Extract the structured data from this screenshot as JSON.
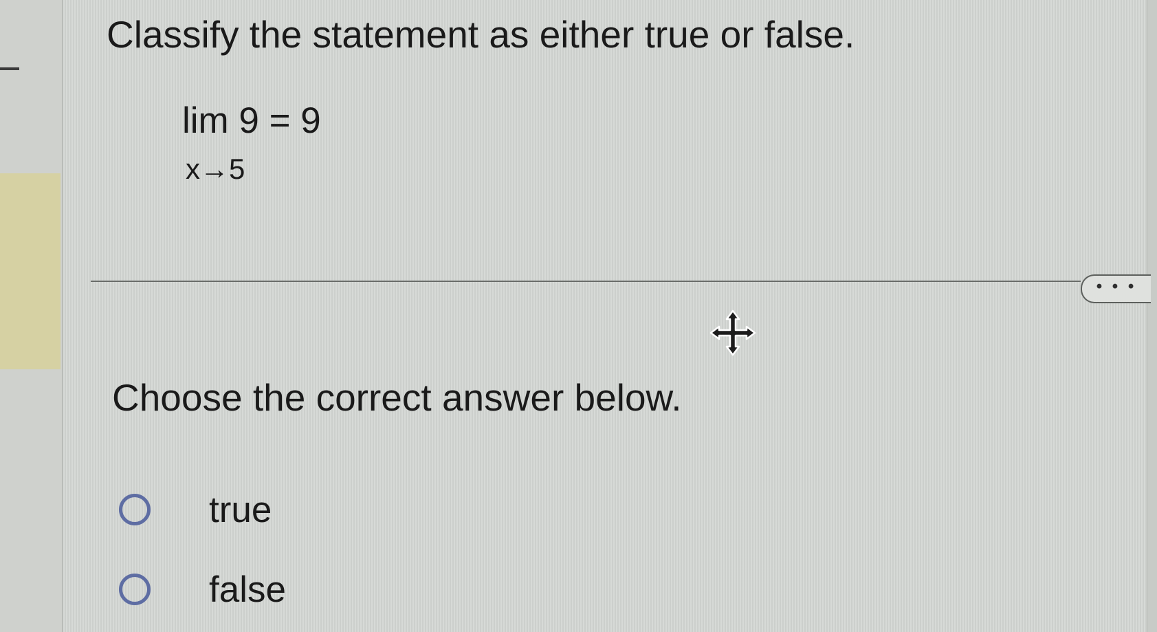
{
  "question": {
    "title": "Classify the statement as either true or false.",
    "limit_expression": "lim 9 = 9",
    "limit_subscript": "x→5"
  },
  "more_button": {
    "label": "• • •"
  },
  "answer": {
    "prompt": "Choose the correct answer below.",
    "options": [
      {
        "label": "true",
        "selected": false
      },
      {
        "label": "false",
        "selected": false
      }
    ]
  },
  "icons": {
    "cursor": "move-cursor-icon",
    "radio": "radio-button-icon"
  },
  "colors": {
    "radio_border": "#5e6da3",
    "side_tab": "#d6d1a3",
    "background": "#d3d6d3"
  }
}
